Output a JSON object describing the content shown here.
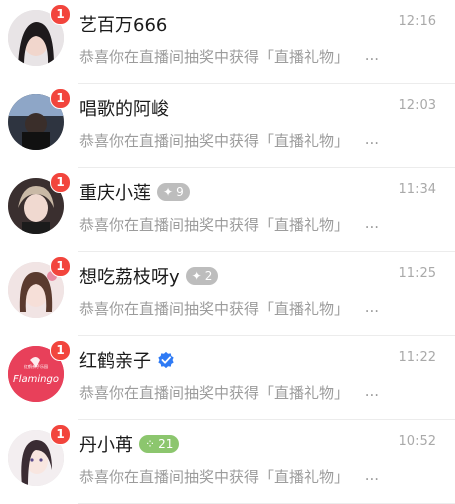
{
  "conversations": [
    {
      "name": "艺百万666",
      "time": "12:16",
      "badge": "1",
      "preview": "恭喜你在直播间抽奖中获得「直播礼物」",
      "more": "..."
    },
    {
      "name": "唱歌的阿峻",
      "time": "12:03",
      "badge": "1",
      "preview": "恭喜你在直播间抽奖中获得「直播礼物」",
      "more": "..."
    },
    {
      "name": "重庆小莲",
      "time": "11:34",
      "badge": "1",
      "preview": "恭喜你在直播间抽奖中获得「直播礼物」",
      "more": "...",
      "tag": "9",
      "tag_icon": "✦"
    },
    {
      "name": "想吃荔枝呀y",
      "time": "11:25",
      "badge": "1",
      "preview": "恭喜你在直播间抽奖中获得「直播礼物」",
      "more": "...",
      "tag": "2",
      "tag_icon": "✦"
    },
    {
      "name": "红鹤亲子",
      "time": "11:22",
      "badge": "1",
      "preview": "恭喜你在直播间抽奖中获得「直播礼物」",
      "more": "...",
      "verified": true,
      "avatar_text": "Flamingo",
      "avatar_subtext": "红鹤亲子乐园"
    },
    {
      "name": "丹小苒",
      "time": "10:52",
      "badge": "1",
      "preview": "恭喜你在直播间抽奖中获得「直播礼物」",
      "more": "...",
      "tag": "21",
      "tag_icon": "⁘",
      "tag_color": "#8cc66e"
    }
  ],
  "colors": {
    "badge": "#f2453d",
    "verified": "#2f7bf5"
  }
}
